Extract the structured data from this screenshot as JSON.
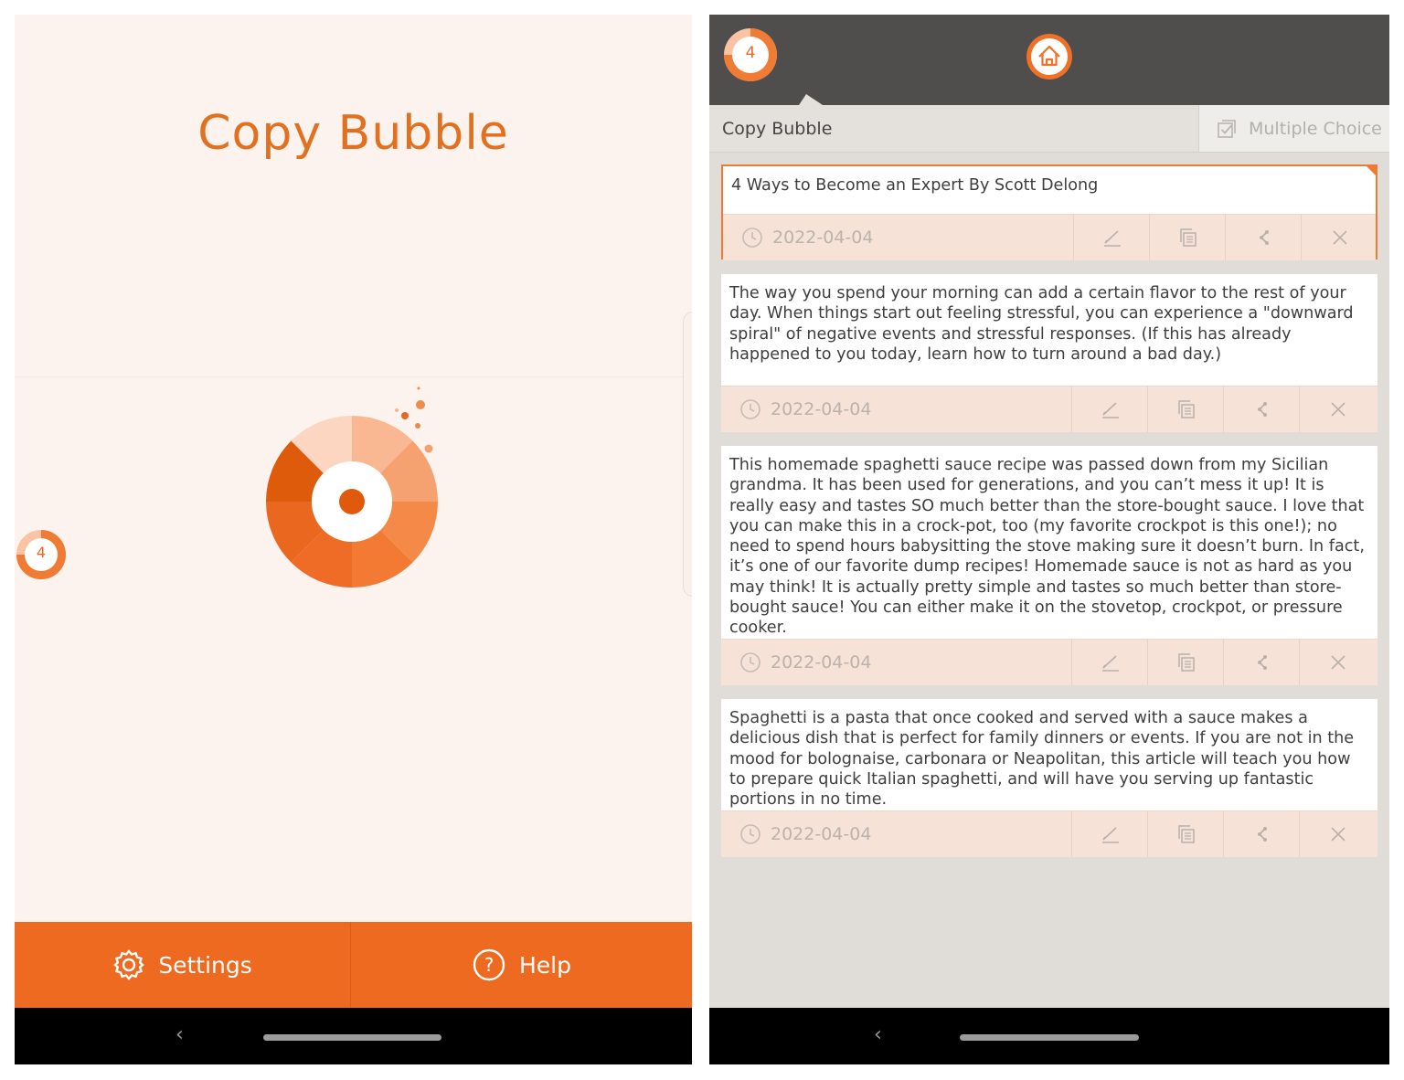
{
  "left": {
    "title": "Copy Bubble",
    "bubble_count": "4",
    "footer": {
      "settings_label": "Settings",
      "help_label": "Help"
    }
  },
  "right": {
    "header": {
      "bubble_count": "4",
      "home_icon": "home-icon"
    },
    "tabs": [
      {
        "label": "Copy Bubble"
      },
      {
        "label": "Multiple Choice"
      }
    ],
    "items": [
      {
        "text": "4 Ways to Become an Expert By Scott Delong",
        "date": "2022-04-04"
      },
      {
        "text": "The way you spend your morning can add a certain flavor to the rest of your day. When things start out feeling stressful, you can experience a \"downward spiral\" of negative events and stressful responses. (If this has already happened to you today, learn how to turn around a bad day.)",
        "date": "2022-04-04"
      },
      {
        "text": "This homemade spaghetti sauce recipe was passed down from my Sicilian grandma. It has been used for generations, and you can’t mess it up! It is really easy and tastes SO much better than the store-bought sauce. I love that you can make this in a crock-pot, too (my favorite crockpot is this one!); no need to spend hours babysitting the stove making sure it doesn’t burn. In fact, it’s one of our favorite dump recipes! Homemade sauce is not as hard as you may think! It is actually pretty simple and tastes so much better than store-bought sauce! You can either make it on the stovetop, crockpot, or pressure cooker.",
        "date": "2022-04-04"
      },
      {
        "text": "Spaghetti is a pasta that once cooked and served with a sauce makes a delicious dish that is perfect for family dinners or events. If you are not in the mood for bolognaise, carbonara or Neapolitan, this article will teach you how to prepare quick Italian spaghetti, and will have you serving up fantastic portions in no time.",
        "date": "2022-04-04"
      }
    ]
  },
  "nav": {
    "back_glyph": "‹"
  },
  "colors": {
    "accent": "#ed6a20",
    "header": "#4f4e4c",
    "left_bg": "#fdf3ee",
    "right_bg": "#e0ddd8"
  }
}
